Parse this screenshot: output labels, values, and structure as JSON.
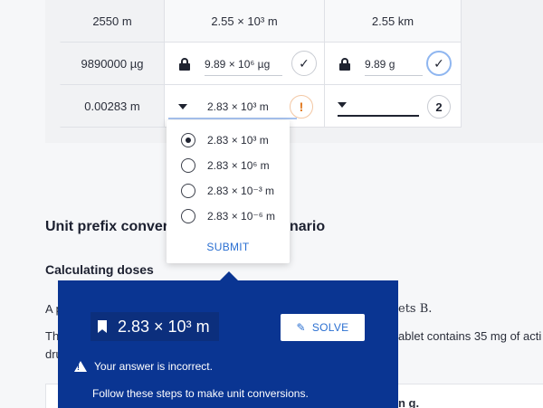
{
  "table": {
    "rows": [
      {
        "given": "2550 m",
        "answer": "2.55 × 10³ m",
        "converted": "2.55 km"
      },
      {
        "given": "9890000 µg",
        "answer": "9.89 × 10⁶ µg",
        "answer_status": "✓",
        "converted": "9.89 g",
        "converted_status": "✓"
      },
      {
        "given": "0.00283 m",
        "answer": "2.83 × 10³ m",
        "answer_status": "!",
        "converted": "",
        "converted_status": "2"
      }
    ]
  },
  "dropdown": {
    "options": [
      {
        "label": "2.83 × 10³ m",
        "selected": true
      },
      {
        "label": "2.83 × 10⁶ m",
        "selected": false
      },
      {
        "label": "2.83 × 10⁻³ m",
        "selected": false
      },
      {
        "label": "2.83 × 10⁻⁶ m",
        "selected": false
      }
    ],
    "submit_label": "SUBMIT"
  },
  "content": {
    "section_heading_left": "Unit prefix conver",
    "section_heading_right": "nario",
    "subheading": "Calculating doses",
    "para1_left": "A p",
    "para1_right": "ets B.",
    "para2_left": "Th",
    "para2_right": "ablet contains 35 mg of acti",
    "para3_left": "dru",
    "para4_right": "n g."
  },
  "feedback": {
    "answer": "2.83 × 10³ m",
    "solve_label": "SOLVE",
    "message": "Your answer is incorrect.",
    "instruction": "Follow these steps to make unit conversions."
  },
  "colors": {
    "panel": "#0a3592",
    "accent": "#2a6fd1",
    "warning": "#e0761a"
  }
}
